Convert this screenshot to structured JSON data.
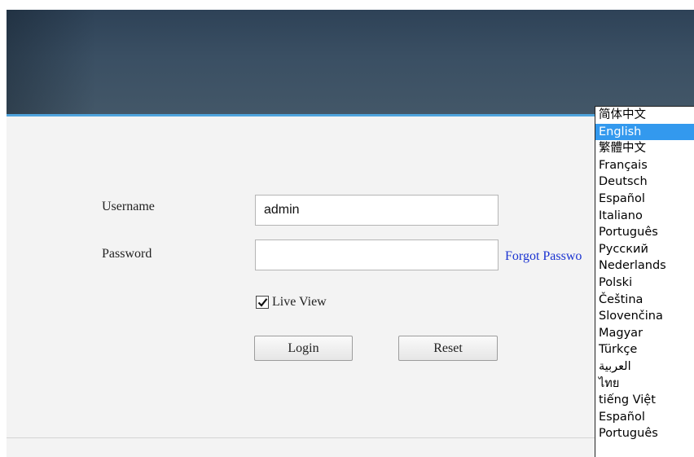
{
  "login": {
    "username_label": "Username",
    "username_value": "admin",
    "password_label": "Password",
    "password_value": "",
    "forgot_password": "Forgot Passwo",
    "live_view_label": "Live View",
    "live_view_checked": true,
    "login_button": "Login",
    "reset_button": "Reset"
  },
  "language_list": {
    "selected": "English",
    "items": [
      "简体中文",
      "English",
      "繁體中文",
      "Français",
      "Deutsch",
      "Español",
      "Italiano",
      "Português",
      "Русский",
      "Nederlands",
      "Polski",
      "Čeština",
      "Slovenčina",
      "Magyar",
      "Türkçe",
      "العربية",
      "ไทย",
      "tiếng Việt",
      "Español",
      "Português"
    ]
  },
  "colors": {
    "header_bg": "#3a4f63",
    "accent_stripe": "#4fa3dc",
    "panel_bg": "#f3f3f3",
    "link": "#1a33d1",
    "selection": "#3399ee"
  }
}
